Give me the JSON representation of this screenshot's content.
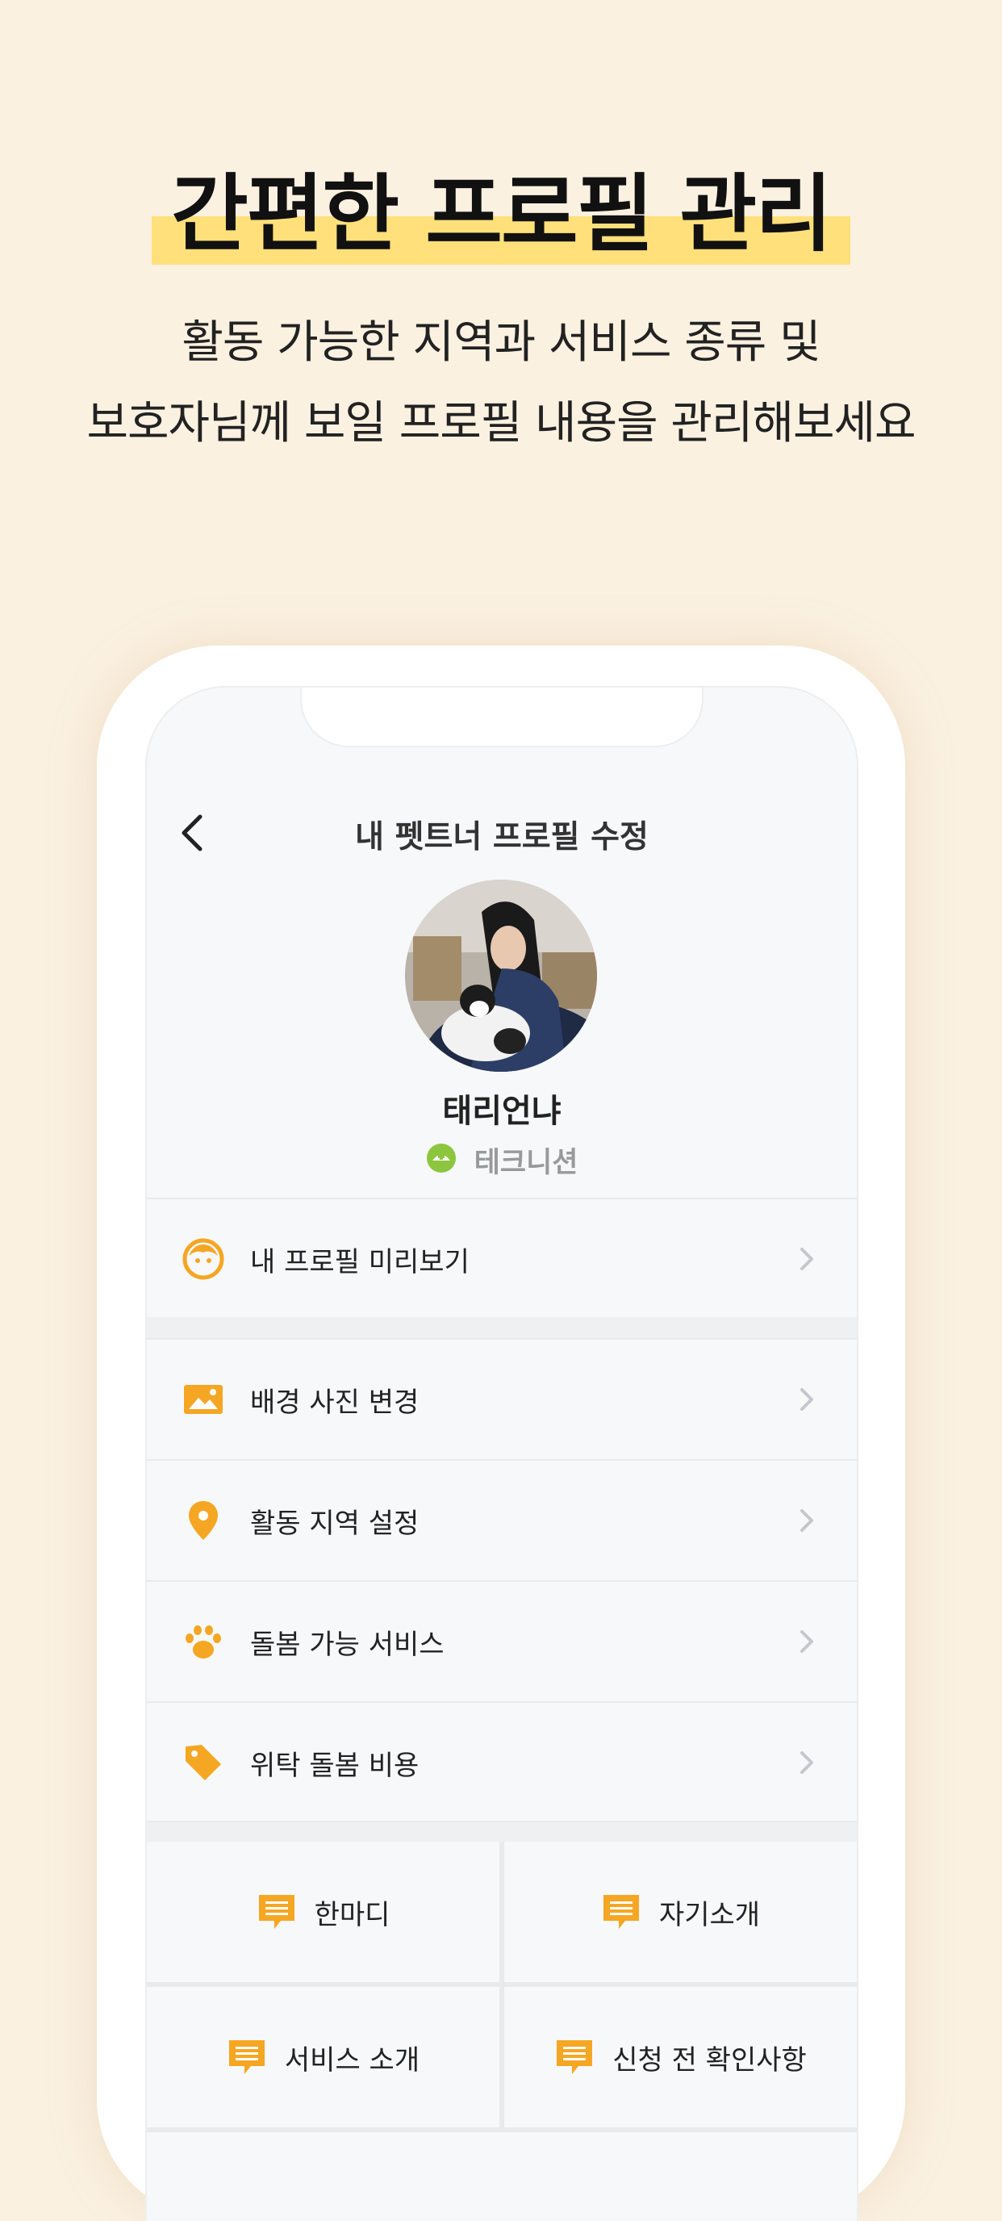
{
  "headline": "간편한 프로필 관리",
  "subtitle": {
    "line1": "활동 가능한 지역과 서비스 종류 및",
    "line2": "보호자님께 보일 프로필 내용을 관리해보세요"
  },
  "screen": {
    "nav_title": "내 펫트너 프로필 수정",
    "profile": {
      "name": "태리언냐",
      "role": "테크니션"
    },
    "preview_item": {
      "label": "내 프로필 미리보기",
      "icon": "face-icon"
    },
    "menu_items": [
      {
        "label": "배경 사진 변경",
        "icon": "image-icon"
      },
      {
        "label": "활동 지역 설정",
        "icon": "location-pin-icon"
      },
      {
        "label": "돌봄 가능 서비스",
        "icon": "paw-icon"
      },
      {
        "label": "위탁 돌봄 비용",
        "icon": "price-tag-icon"
      }
    ],
    "grid_items": [
      {
        "label": "한마디",
        "icon": "message-icon"
      },
      {
        "label": "자기소개",
        "icon": "message-icon"
      },
      {
        "label": "서비스 소개",
        "icon": "message-icon"
      },
      {
        "label": "신청 전 확인사항",
        "icon": "message-icon"
      }
    ]
  },
  "colors": {
    "background": "#FBF1E1",
    "highlight": "#FFE07A",
    "accent": "#F5A623",
    "role_badge": "#8CC63F"
  }
}
